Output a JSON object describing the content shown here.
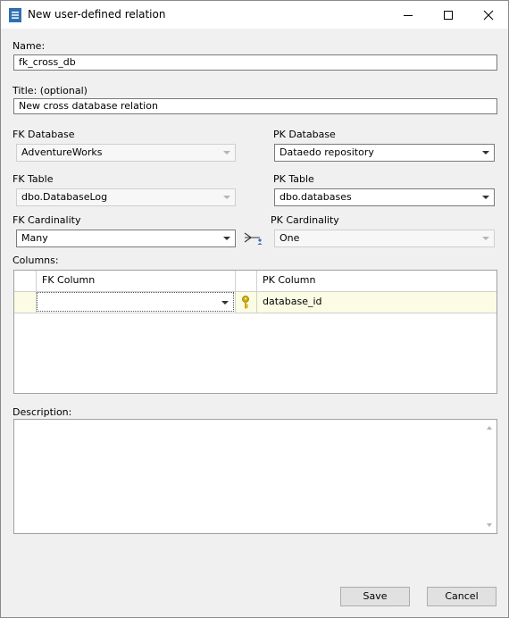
{
  "window": {
    "title": "New user-defined relation",
    "icon": "dataedo-app-icon",
    "controls": {
      "minimize": "minimize-icon",
      "maximize": "maximize-icon",
      "close": "close-icon"
    }
  },
  "form": {
    "name_label": "Name:",
    "name_value": "fk_cross_db",
    "title_label": "Title: (optional)",
    "title_value": "New cross database relation",
    "fk_database_label": "FK Database",
    "fk_database_value": "AdventureWorks",
    "pk_database_label": "PK Database",
    "pk_database_value": "Dataedo repository",
    "fk_table_label": "FK Table",
    "fk_table_value": "dbo.DatabaseLog",
    "pk_table_label": "PK Table",
    "pk_table_value": "dbo.databases",
    "fk_cardinality_label": "FK Cardinality",
    "fk_cardinality_value": "Many",
    "pk_cardinality_label": "PK Cardinality",
    "pk_cardinality_value": "One",
    "cardinality_icon": "many-to-one-relation-icon",
    "columns_label": "Columns:",
    "description_label": "Description:"
  },
  "columns_grid": {
    "headers": {
      "fk_column": "FK Column",
      "pk_column": "PK Column"
    },
    "rows": [
      {
        "fk_column": "",
        "key_icon": "key-icon",
        "pk_column": "database_id"
      }
    ]
  },
  "buttons": {
    "save": "Save",
    "cancel": "Cancel"
  },
  "colors": {
    "key": "#c9a800",
    "row_highlight": "#fcfce4"
  }
}
